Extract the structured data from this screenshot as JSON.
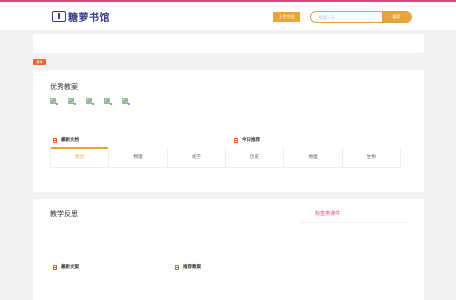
{
  "header": {
    "logo_text": "糖萝书馆",
    "upload_label": "上传文档",
    "search_placeholder": "搜索一下",
    "search_button": "搜索",
    "accent": "#e8a33a",
    "brand_line": "#e0457a"
  },
  "tag": {
    "label": "推荐"
  },
  "section1": {
    "title": "优秀教案",
    "thumb_count": 5,
    "left_head": "最新文档",
    "right_head": "今日推荐",
    "tabs": [
      {
        "label": "政治",
        "active": true
      },
      {
        "label": "物理",
        "active": false
      },
      {
        "label": "化学",
        "active": false
      },
      {
        "label": "历史",
        "active": false
      },
      {
        "label": "地理",
        "active": false
      },
      {
        "label": "生物",
        "active": false
      }
    ]
  },
  "section2": {
    "title": "教学反思",
    "right_link": "标签类课件",
    "left_head": "最新文案",
    "right_head": "推荐教案"
  }
}
